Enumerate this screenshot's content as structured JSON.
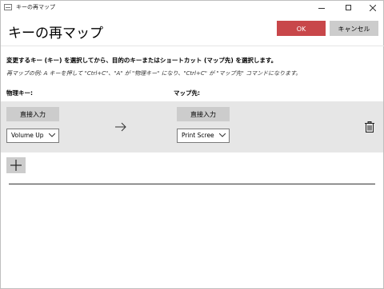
{
  "window": {
    "title": "キーの再マップ",
    "icons": {
      "app": "keyboard-icon",
      "minimize": "minimize-icon",
      "maximize": "maximize-icon",
      "close": "close-icon"
    }
  },
  "header": {
    "title": "キーの再マップ",
    "ok_label": "OK",
    "cancel_label": "キャンセル"
  },
  "body": {
    "instruction": "変更するキー (キー) を選択してから、目的のキーまたはショートカット (マップ先) を選択します。",
    "example": "再マップの例: A キーを押して \"Ctrl+C\"、\"A\" が \"物理キー\" になり、\"Ctrl+C\" が \"マップ先\" コマンドになります。"
  },
  "columns": {
    "physical_label": "物理キー:",
    "mapped_label": "マップ先:"
  },
  "mappings": [
    {
      "type_button_label": "直接入力",
      "physical_key": "Volume Up",
      "mapped_type_button_label": "直接入力",
      "mapped_key": "Print Scree",
      "icons": {
        "arrow": "arrow-right-icon",
        "delete": "trash-icon",
        "chevron": "chevron-down-icon"
      }
    }
  ],
  "add_button": {
    "icon": "plus-icon"
  },
  "colors": {
    "accent": "#c8474a",
    "row_background": "#e6e6e6",
    "button_gray": "#cccccc"
  }
}
